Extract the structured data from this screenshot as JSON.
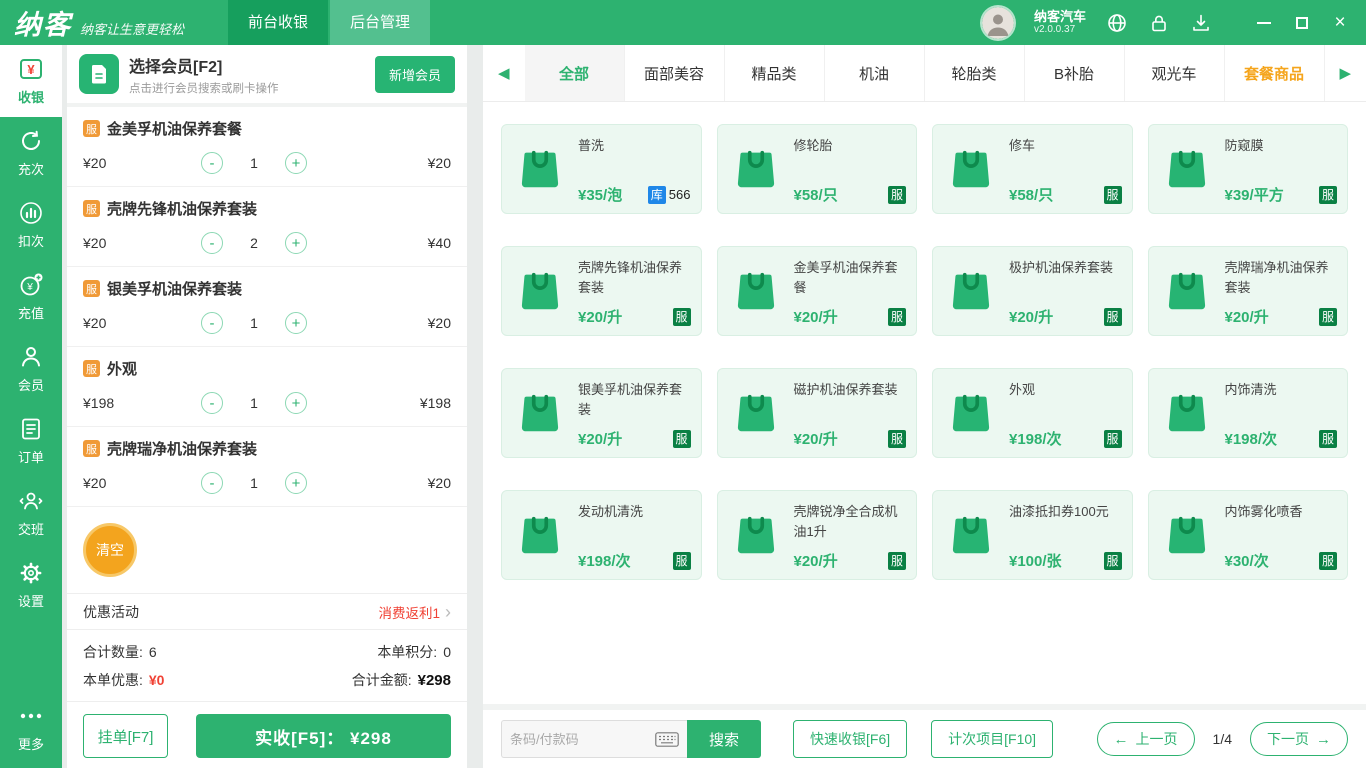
{
  "topbar": {
    "logo": "纳客",
    "slogan": "纳客让生意更轻松",
    "tabs": [
      {
        "label": "前台收银"
      },
      {
        "label": "后台管理"
      }
    ],
    "store_name": "纳客汽车",
    "version": "v2.0.0.37"
  },
  "sidebar": {
    "items": [
      {
        "label": "收银"
      },
      {
        "label": "充次"
      },
      {
        "label": "扣次"
      },
      {
        "label": "充值"
      },
      {
        "label": "会员"
      },
      {
        "label": "订单"
      },
      {
        "label": "交班"
      },
      {
        "label": "设置"
      },
      {
        "label": "更多"
      }
    ]
  },
  "member": {
    "title": "选择会员[F2]",
    "subtitle": "点击进行会员搜索或刷卡操作",
    "add_button": "新增会员"
  },
  "cart": {
    "items": [
      {
        "badge": "服",
        "name": "金美孚机油保养套餐",
        "price": "¥20",
        "qty": "1",
        "total": "¥20"
      },
      {
        "badge": "服",
        "name": "壳牌先锋机油保养套装",
        "price": "¥20",
        "qty": "2",
        "total": "¥40"
      },
      {
        "badge": "服",
        "name": "银美孚机油保养套装",
        "price": "¥20",
        "qty": "1",
        "total": "¥20"
      },
      {
        "badge": "服",
        "name": "外观",
        "price": "¥198",
        "qty": "1",
        "total": "¥198"
      },
      {
        "badge": "服",
        "name": "壳牌瑞净机油保养套装",
        "price": "¥20",
        "qty": "1",
        "total": "¥20"
      }
    ],
    "clear_button": "清空",
    "promo_label": "优惠活动",
    "promo_value": "消费返利1",
    "summary": {
      "qty_label": "合计数量:",
      "qty_value": "6",
      "points_label": "本单积分:",
      "points_value": "0",
      "discount_label": "本单优惠:",
      "discount_value": "¥0",
      "total_label": "合计金额:",
      "total_value": "¥298"
    },
    "hold_button": "挂单[F7]",
    "checkout_button": "实收[F5]： ¥298"
  },
  "categories": {
    "tabs": [
      {
        "label": "全部"
      },
      {
        "label": "面部美容"
      },
      {
        "label": "精品类"
      },
      {
        "label": "机油"
      },
      {
        "label": "轮胎类"
      },
      {
        "label": "B补胎"
      },
      {
        "label": "观光车"
      },
      {
        "label": "套餐商品"
      }
    ]
  },
  "products": [
    {
      "name": "普洗",
      "price": "¥35/泡",
      "stock_badge": "库",
      "stock": "566"
    },
    {
      "name": "修轮胎",
      "price": "¥58/只",
      "badge": "服"
    },
    {
      "name": "修车",
      "price": "¥58/只",
      "badge": "服"
    },
    {
      "name": "防窥膜",
      "price": "¥39/平方",
      "badge": "服"
    },
    {
      "name": "壳牌先锋机油保养套装",
      "price": "¥20/升",
      "badge": "服"
    },
    {
      "name": "金美孚机油保养套餐",
      "price": "¥20/升",
      "badge": "服"
    },
    {
      "name": "极护机油保养套装",
      "price": "¥20/升",
      "badge": "服"
    },
    {
      "name": "壳牌瑞净机油保养套装",
      "price": "¥20/升",
      "badge": "服"
    },
    {
      "name": "银美孚机油保养套装",
      "price": "¥20/升",
      "badge": "服"
    },
    {
      "name": "磁护机油保养套装",
      "price": "¥20/升",
      "badge": "服"
    },
    {
      "name": "外观",
      "price": "¥198/次",
      "badge": "服"
    },
    {
      "name": "内饰清洗",
      "price": "¥198/次",
      "badge": "服"
    },
    {
      "name": "发动机清洗",
      "price": "¥198/次",
      "badge": "服"
    },
    {
      "name": "壳牌锐净全合成机油1升",
      "price": "¥20/升",
      "badge": "服"
    },
    {
      "name": "油漆抵扣券100元",
      "price": "¥100/张",
      "badge": "服"
    },
    {
      "name": "内饰雾化喷香",
      "price": "¥30/次",
      "badge": "服"
    }
  ],
  "bottom_bar": {
    "search_placeholder": "条码/付款码",
    "search_button": "搜索",
    "quick_cashier_button": "快速收银[F6]",
    "count_item_button": "计次项目[F10]",
    "prev_page": "上一页",
    "page_indicator": "1/4",
    "next_page": "下一页"
  },
  "icons": {
    "prev_arrow": "←",
    "next_arrow": "→",
    "chevron_right": "›",
    "cat_left": "◀",
    "cat_right": "▶",
    "close": "×"
  },
  "colors": {
    "primary_green": "#2db270",
    "active_tab_green": "#169f5d",
    "service_badge_green": "#0a8044",
    "stock_badge_blue": "#1f87e8",
    "clear_button_orange": "#f3a41e",
    "package_badge_orange": "#f09a37",
    "price_red": "#f04134",
    "highlight_tab_orange": "#f5a51d"
  }
}
